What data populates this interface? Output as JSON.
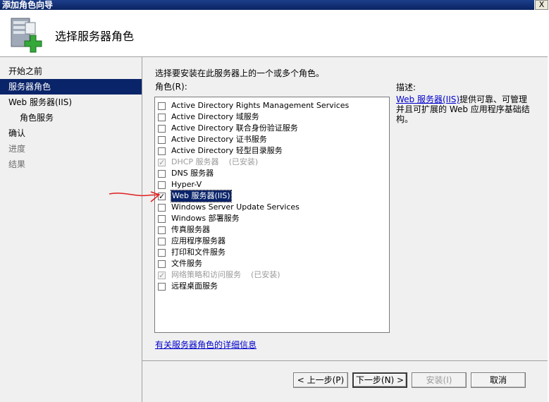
{
  "window": {
    "title": "添加角色向导",
    "close_label": "X"
  },
  "header": {
    "page_title": "选择服务器角色",
    "icon": "server-add-icon"
  },
  "nav": {
    "items": [
      {
        "label": "开始之前",
        "state": "normal",
        "level": 0
      },
      {
        "label": "服务器角色",
        "state": "selected",
        "level": 0
      },
      {
        "label": "Web 服务器(IIS)",
        "state": "normal",
        "level": 0
      },
      {
        "label": "角色服务",
        "state": "normal",
        "level": 1
      },
      {
        "label": "确认",
        "state": "normal",
        "level": 0
      },
      {
        "label": "进度",
        "state": "disabled",
        "level": 0
      },
      {
        "label": "结果",
        "state": "disabled",
        "level": 0
      }
    ]
  },
  "main": {
    "instruction": "选择要安装在此服务器上的一个或多个角色。",
    "roles_label": "角色(R):",
    "roles": [
      {
        "name": "Active Directory Rights Management Services",
        "checked": false,
        "disabled": false,
        "installed_note": ""
      },
      {
        "name": "Active Directory 域服务",
        "checked": false,
        "disabled": false,
        "installed_note": ""
      },
      {
        "name": "Active Directory 联合身份验证服务",
        "checked": false,
        "disabled": false,
        "installed_note": ""
      },
      {
        "name": "Active Directory 证书服务",
        "checked": false,
        "disabled": false,
        "installed_note": ""
      },
      {
        "name": "Active Directory 轻型目录服务",
        "checked": false,
        "disabled": false,
        "installed_note": ""
      },
      {
        "name": "DHCP 服务器",
        "checked": true,
        "disabled": true,
        "installed_note": "(已安装)"
      },
      {
        "name": "DNS 服务器",
        "checked": false,
        "disabled": false,
        "installed_note": ""
      },
      {
        "name": "Hyper-V",
        "checked": false,
        "disabled": false,
        "installed_note": ""
      },
      {
        "name": "Web 服务器(IIS)",
        "checked": true,
        "disabled": false,
        "installed_note": "",
        "selected": true
      },
      {
        "name": "Windows Server Update Services",
        "checked": false,
        "disabled": false,
        "installed_note": ""
      },
      {
        "name": "Windows 部署服务",
        "checked": false,
        "disabled": false,
        "installed_note": ""
      },
      {
        "name": "传真服务器",
        "checked": false,
        "disabled": false,
        "installed_note": ""
      },
      {
        "name": "应用程序服务器",
        "checked": false,
        "disabled": false,
        "installed_note": ""
      },
      {
        "name": "打印和文件服务",
        "checked": false,
        "disabled": false,
        "installed_note": ""
      },
      {
        "name": "文件服务",
        "checked": false,
        "disabled": false,
        "installed_note": ""
      },
      {
        "name": "网络策略和访问服务",
        "checked": true,
        "disabled": true,
        "installed_note": "(已安装)"
      },
      {
        "name": "远程桌面服务",
        "checked": false,
        "disabled": false,
        "installed_note": ""
      }
    ],
    "description_label": "描述:",
    "description_link": "Web 服务器(IIS)",
    "description_text": "提供可靠、可管理并且可扩展的 Web 应用程序基础结构。",
    "more_info_link": "有关服务器角色的详细信息"
  },
  "buttons": {
    "previous": "< 上一步(P)",
    "next": "下一步(N) >",
    "install": "安装(I)",
    "cancel": "取消"
  },
  "colors": {
    "selection": "#0a246a",
    "link": "#0000cc",
    "annotation_arrow": "#e02020"
  }
}
